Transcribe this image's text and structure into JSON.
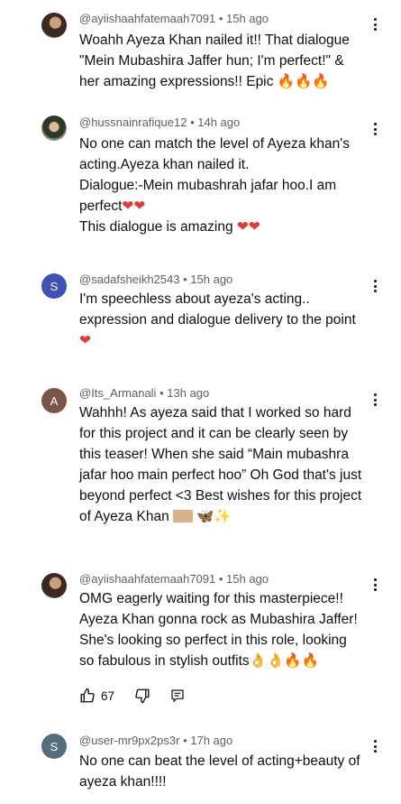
{
  "comments": [
    {
      "handle": "@ayiishaahfatemaah7091",
      "time": "15h ago",
      "lines": [
        "Woahh Ayeza Khan nailed it!! That dialogue",
        "\"Mein Mubashira Jaffer hun; I'm perfect!\" &",
        "her amazing expressions!! Epic"
      ],
      "emoji": "🔥🔥🔥",
      "avatar": "profile-photo"
    },
    {
      "handle": "@hussnainrafique12",
      "time": "14h ago",
      "lines": [
        "No one can match the level of Ayeza khan's",
        "acting.Ayeza khan nailed it.",
        "Dialogue:-Mein mubashrah jafar hoo.I am",
        "perfect",
        "This dialogue is amazing "
      ],
      "emoji1": "❤❤",
      "emoji2": "❤❤",
      "avatar": "profile-photo"
    },
    {
      "handle": "@sadafsheikh2543",
      "time": "15h ago",
      "lines": [
        "I'm speechless about ayeza's acting..",
        "expression and dialogue delivery to the point"
      ],
      "emoji": "❤",
      "avatar_letter": "S"
    },
    {
      "handle": "@Its_Armanali",
      "time": "13h ago",
      "lines": [
        "Wahhh! As ayeza said that I worked so hard",
        "for this project and it can be clearly seen by",
        "this teaser! When she said “Main mubashra",
        "jafar hoo main perfect hoo” Oh God that's just",
        "beyond perfect <3 Best wishes for this project",
        "of Ayeza Khan "
      ],
      "emoji": "🦋✨",
      "avatar_letter": "A"
    },
    {
      "handle": "@ayiishaahfatemaah7091",
      "time": "15h ago",
      "lines": [
        "OMG eagerly waiting for this masterpiece!!",
        "Ayeza Khan gonna rock as Mubashira Jaffer!",
        "She's looking so perfect in this role, looking",
        "so fabulous in stylish outfits"
      ],
      "emoji": "👌👌🔥🔥",
      "avatar": "profile-photo",
      "likes": "67"
    },
    {
      "handle": "@user-mr9px2ps3r",
      "time": "17h ago",
      "lines": [
        "No one can beat the level of acting+beauty of",
        "ayeza khan!!!!"
      ],
      "avatar_letter": "S"
    }
  ],
  "separator": " • ",
  "icons": {
    "more": "more-vert-icon",
    "like": "thumb-up-icon",
    "dislike": "thumb-down-icon",
    "reply": "reply-icon"
  }
}
